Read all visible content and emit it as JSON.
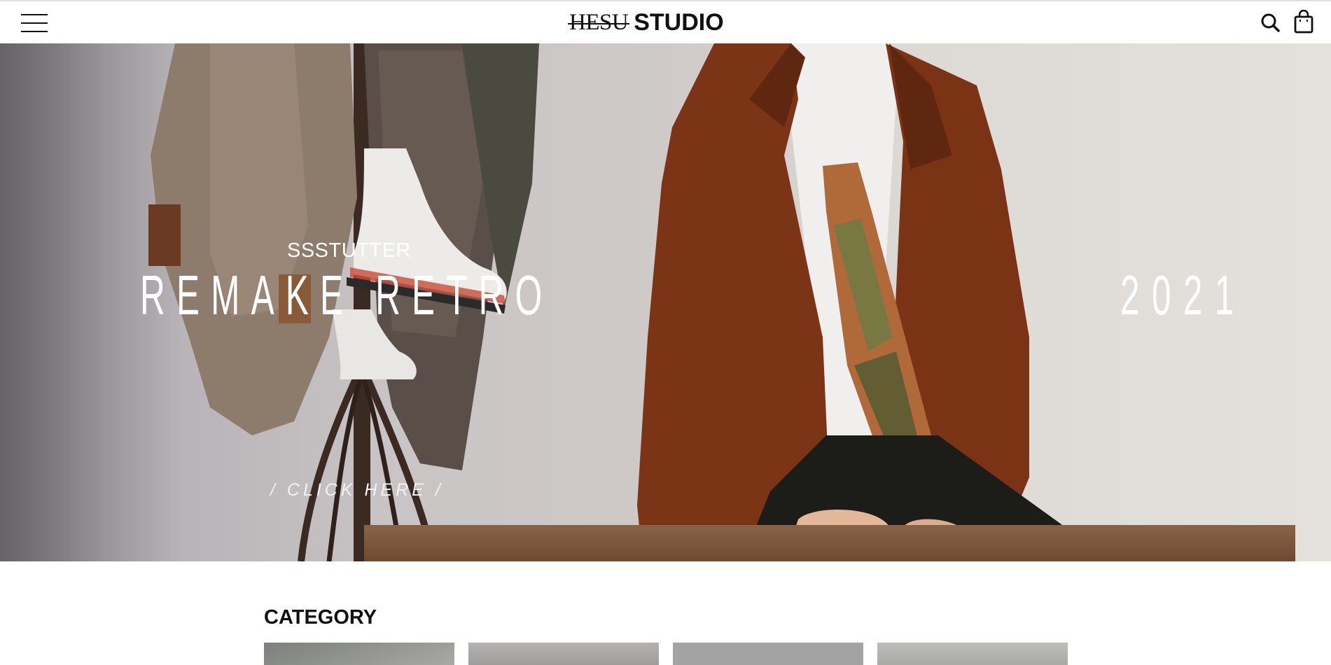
{
  "header": {
    "logo_serif": "HESU",
    "logo_sans": "STUDIO",
    "menu_icon": "hamburger-menu-icon",
    "search_icon": "search-icon",
    "cart_icon": "shopping-bag-icon"
  },
  "hero": {
    "subtitle": "SSSTUTTER",
    "title": "REMAKE RETRO",
    "year": "2021",
    "cta": "/ CLICK HERE /"
  },
  "category": {
    "heading": "CATEGORY",
    "tile_colors": [
      "#8e8f8d",
      "#a9a8a6",
      "#a3a3a3",
      "#b3b3b1"
    ]
  }
}
